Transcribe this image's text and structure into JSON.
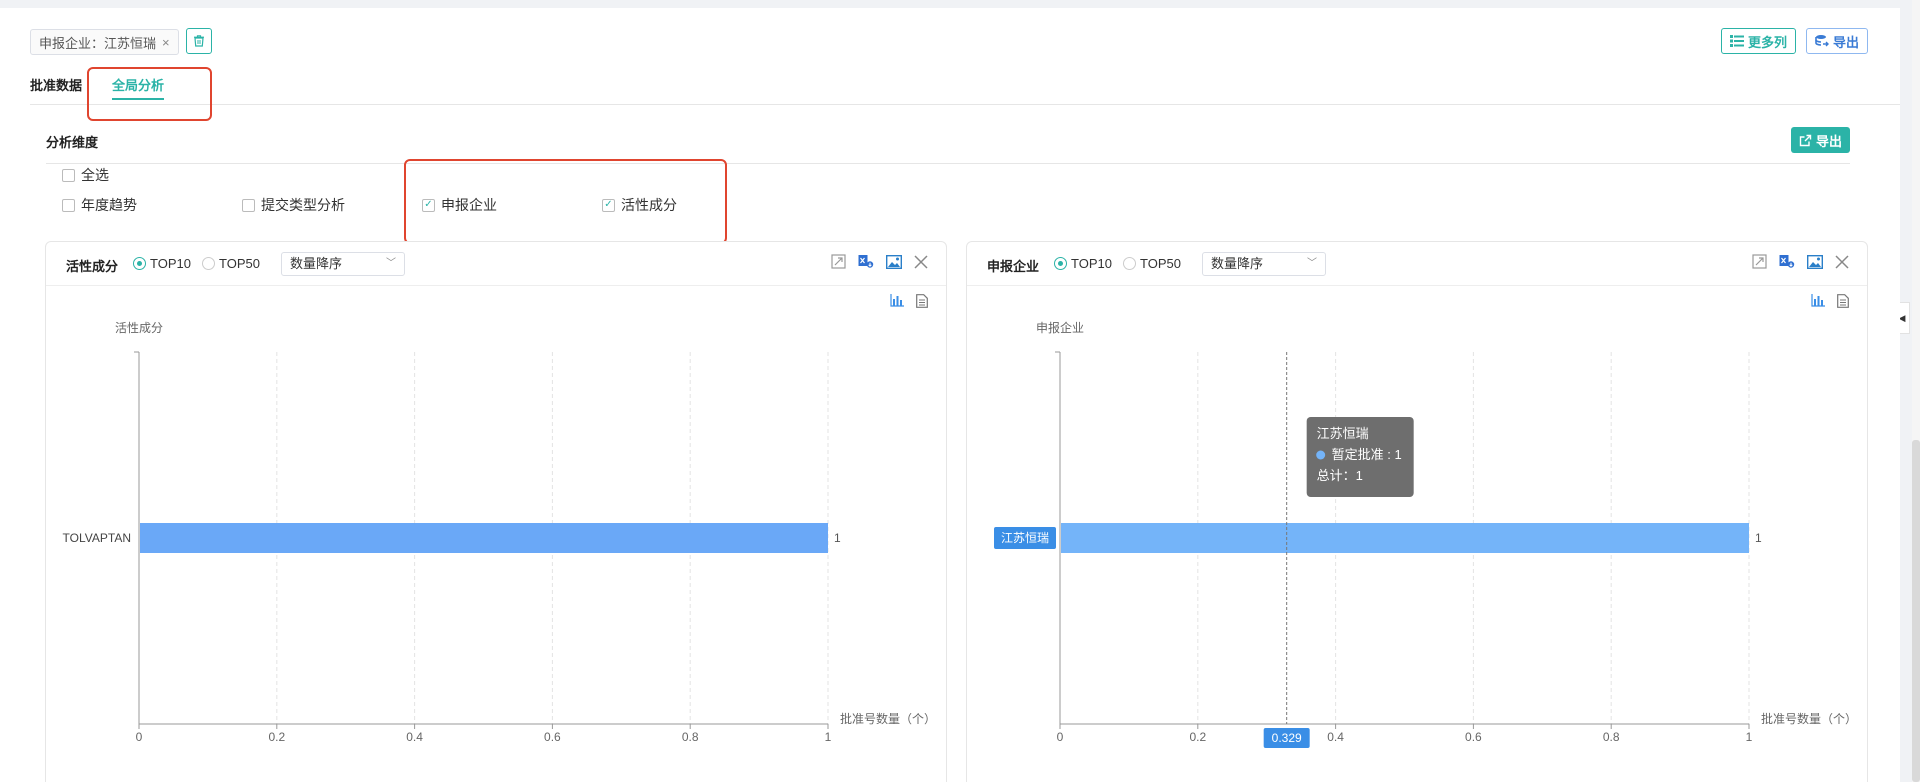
{
  "filter": {
    "tag_label": "申报企业：江苏恒瑞",
    "remove_glyph": "×"
  },
  "toolbar": {
    "more_columns_label": "更多列",
    "export_label": "导出"
  },
  "tabs": [
    {
      "label": "批准数据",
      "active": false
    },
    {
      "label": "全局分析",
      "active": true
    }
  ],
  "dimension": {
    "title": "分析维度",
    "export_label": "导出",
    "select_all": "全选",
    "options": [
      {
        "label": "年度趋势",
        "checked": false
      },
      {
        "label": "提交类型分析",
        "checked": false
      },
      {
        "label": "申报企业",
        "checked": true
      },
      {
        "label": "活性成分",
        "checked": true
      }
    ]
  },
  "panels": [
    {
      "title": "活性成分",
      "radio_top10": "TOP10",
      "radio_top50": "TOP50",
      "sort_select": "数量降序"
    },
    {
      "title": "申报企业",
      "radio_top10": "TOP10",
      "radio_top50": "TOP50",
      "sort_select": "数量降序"
    }
  ],
  "icons": {
    "trash": "trash-icon",
    "list": "list-icon",
    "database_export": "database-export-icon",
    "external_link": "external-link-icon",
    "fullscreen": "fullscreen-icon",
    "excel": "excel-icon",
    "image": "image-icon",
    "close": "close-icon",
    "bar_chart": "bar-chart-icon",
    "data_view": "data-view-icon",
    "collapse": "collapse-arrow-icon"
  },
  "colors": {
    "accent": "#2bb3a7",
    "bar_left": "#6aa8f7",
    "bar_right": "#74b4f9",
    "highlight": "#e0452f",
    "tooltip_bg": "#6e6e6e",
    "axis_pointer_label": "#3a8ee6"
  },
  "chart_data": [
    {
      "type": "bar",
      "orientation": "horizontal",
      "ylabel": "活性成分",
      "xlabel": "批准号数量（个）",
      "categories": [
        "TOLVAPTAN"
      ],
      "values": [
        1
      ],
      "xlim": [
        0,
        1
      ],
      "xticks": [
        "0",
        "0.2",
        "0.4",
        "0.6",
        "0.8",
        "1"
      ],
      "grid": true
    },
    {
      "type": "bar",
      "orientation": "horizontal",
      "ylabel": "申报企业",
      "xlabel": "批准号数量（个）",
      "categories": [
        "江苏恒瑞"
      ],
      "series": [
        {
          "name": "暂定批准",
          "values": [
            1
          ]
        }
      ],
      "xlim": [
        0,
        1
      ],
      "xticks": [
        "0",
        "0.2",
        "0.4",
        "0.6",
        "0.8",
        "1"
      ],
      "grid": true,
      "axis_pointer": {
        "value": "0.329"
      },
      "tooltip": {
        "title": "江苏恒瑞",
        "series_line": "暂定批准 : 1",
        "total_line": "总计：1"
      }
    }
  ]
}
